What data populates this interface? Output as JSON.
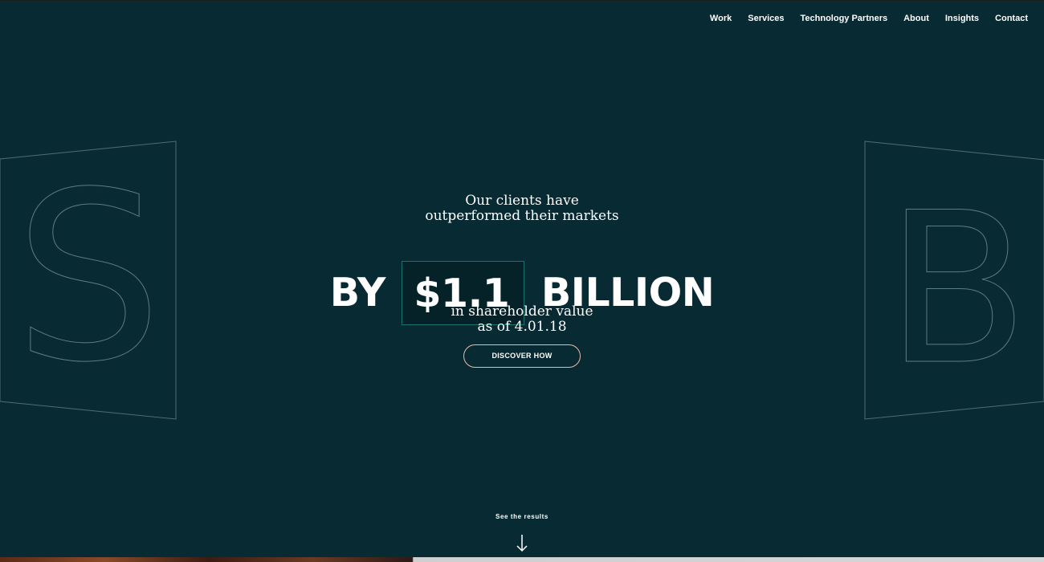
{
  "nav": {
    "items": [
      "Work",
      "Services",
      "Technology Partners",
      "About",
      "Insights",
      "Contact"
    ]
  },
  "hero": {
    "line1": "Our clients have",
    "line2": "outperformed their markets",
    "headline_prefix": "BY",
    "headline_amount": "$1.1",
    "headline_suffix": "BILLION",
    "line3": "in shareholder value",
    "line4": "as of 4.01.18",
    "cta_label": "DISCOVER HOW"
  },
  "decor": {
    "left_letter": "S",
    "right_letter": "B"
  },
  "footer": {
    "see_results": "See the results",
    "arrow_icon": "arrow-down-icon"
  },
  "colors": {
    "background": "#082a33",
    "text": "#ffffff",
    "cta_border": "#e9b9a8",
    "amount_border": "#18716a",
    "outline": "#5f7c84"
  }
}
